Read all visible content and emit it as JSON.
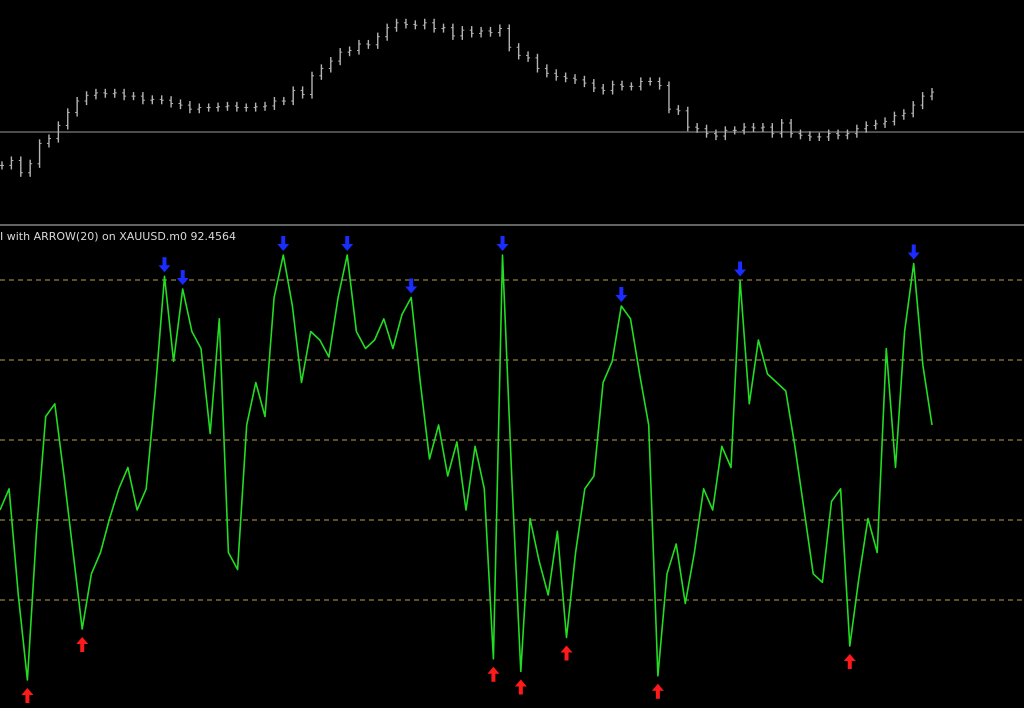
{
  "indicator_label": "I with ARROW(20) on XAUUSD.m0 92.4564",
  "colors": {
    "background": "#000000",
    "price": "#b4b4b4",
    "price_level": "#9a9a9a",
    "oscillator": "#22dd22",
    "levels": "#b9a24a",
    "divider": "#c8c8c8",
    "arrow_up": "#ff1a1a",
    "arrow_down": "#1a2cff"
  },
  "chart_data": [
    {
      "type": "line",
      "series": [
        {
          "values": [
            3.7,
            4.3,
            2.8,
            3.9,
            6.4,
            7.0,
            8.6,
            10.2,
            11.6,
            12.3,
            12.6,
            12.5,
            12.6,
            12.2,
            12.2,
            11.7,
            11.8,
            11.7,
            11.3,
            11.1,
            10.6,
            10.8,
            10.8,
            10.9,
            11.0,
            10.8,
            10.8,
            10.9,
            11.0,
            11.6,
            11.6,
            12.9,
            12.4,
            14.7,
            15.6,
            16.5,
            17.6,
            17.8,
            18.6,
            18.5,
            19.5,
            20.6,
            21.2,
            21.0,
            20.9,
            21.2,
            20.5,
            20.6,
            19.6,
            20.3,
            19.9,
            20.2,
            20.0,
            20.5,
            18.2,
            17.2,
            16.9,
            15.6,
            15.0,
            14.6,
            14.4,
            14.2,
            13.8,
            13.2,
            12.9,
            13.6,
            13.4,
            13.4,
            14.0,
            14.0,
            13.5,
            10.6,
            10.4,
            8.4,
            8.2,
            7.6,
            7.3,
            8.0,
            8.0,
            8.4,
            8.3,
            8.4,
            7.6,
            8.9,
            7.6,
            7.4,
            7.2,
            7.2,
            7.6,
            7.4,
            7.6,
            8.2,
            8.6,
            8.8,
            9.1,
            9.8,
            10.1,
            11.1,
            12.2,
            12.7
          ],
          "level": 7.8
        }
      ]
    },
    {
      "type": "line",
      "series": [
        {
          "values": [
            40,
            45,
            20,
            0,
            35,
            62,
            65,
            48,
            30,
            12,
            25,
            30,
            38,
            45,
            50,
            40,
            45,
            68,
            95,
            75,
            92,
            82,
            78,
            58,
            85,
            30,
            26,
            60,
            70,
            62,
            90,
            100,
            88,
            70,
            82,
            80,
            76,
            90,
            100,
            82,
            78,
            80,
            85,
            78,
            86,
            90,
            70,
            52,
            60,
            48,
            56,
            40,
            55,
            45,
            5,
            100,
            48,
            2,
            38,
            28,
            20,
            35,
            10,
            30,
            45,
            48,
            70,
            75,
            88,
            85,
            72,
            60,
            1,
            25,
            32,
            18,
            30,
            45,
            40,
            55,
            50,
            94,
            65,
            80,
            72,
            70,
            68,
            55,
            40,
            25,
            23,
            42,
            45,
            8,
            24,
            38,
            30,
            78,
            50,
            82,
            98,
            74,
            60
          ]
        }
      ],
      "levels": [
        0,
        20,
        40,
        60,
        80,
        100
      ],
      "ylim": [
        0,
        100
      ]
    }
  ]
}
